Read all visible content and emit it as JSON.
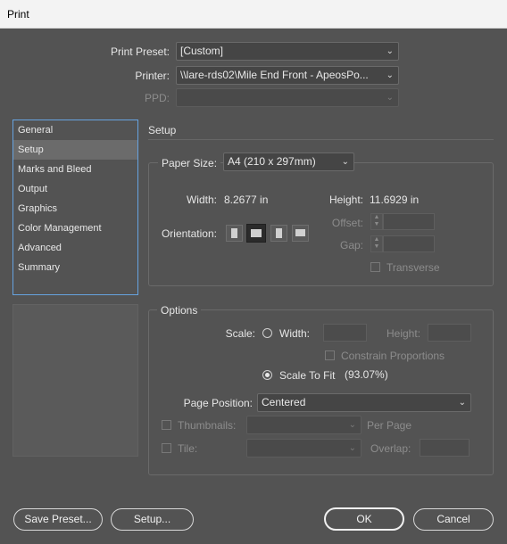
{
  "window": {
    "title": "Print"
  },
  "preset": {
    "label": "Print Preset:",
    "value": "[Custom]"
  },
  "printer": {
    "label": "Printer:",
    "value": "\\\\lare-rds02\\Mile End Front - ApeosPo..."
  },
  "ppd": {
    "label": "PPD:",
    "value": ""
  },
  "sidebar": {
    "items": [
      {
        "label": "General"
      },
      {
        "label": "Setup"
      },
      {
        "label": "Marks and Bleed"
      },
      {
        "label": "Output"
      },
      {
        "label": "Graphics"
      },
      {
        "label": "Color Management"
      },
      {
        "label": "Advanced"
      },
      {
        "label": "Summary"
      }
    ],
    "selected": "Setup"
  },
  "setup": {
    "title": "Setup",
    "paper_size_label": "Paper Size:",
    "paper_size_value": "A4 (210 x 297mm)",
    "width_label": "Width:",
    "width_value": "8.2677 in",
    "height_label": "Height:",
    "height_value": "11.6929 in",
    "orientation_label": "Orientation:",
    "offset_label": "Offset:",
    "gap_label": "Gap:",
    "transverse_label": "Transverse"
  },
  "options": {
    "title": "Options",
    "scale_label": "Scale:",
    "width_label": "Width:",
    "height_label": "Height:",
    "constrain_label": "Constrain Proportions",
    "scale_to_fit_label": "Scale To Fit",
    "scale_to_fit_value": "(93.07%)",
    "page_position_label": "Page Position:",
    "page_position_value": "Centered",
    "thumbnails_label": "Thumbnails:",
    "per_page_label": "Per Page",
    "tile_label": "Tile:",
    "overlap_label": "Overlap:"
  },
  "buttons": {
    "save_preset": "Save Preset...",
    "setup": "Setup...",
    "ok": "OK",
    "cancel": "Cancel"
  }
}
